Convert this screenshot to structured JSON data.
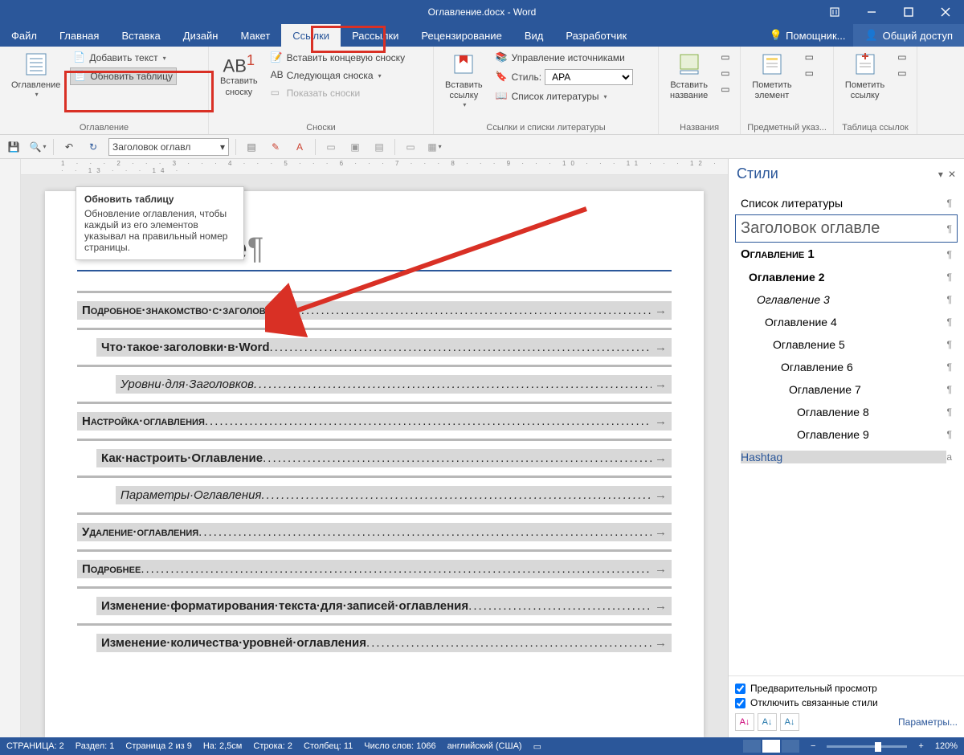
{
  "titlebar": {
    "title": "Оглавление.docx - Word"
  },
  "menu": {
    "tabs": [
      "Файл",
      "Главная",
      "Вставка",
      "Дизайн",
      "Макет",
      "Ссылки",
      "Рассылки",
      "Рецензирование",
      "Вид",
      "Разработчик"
    ],
    "active": "Ссылки",
    "help": "Помощник...",
    "share": "Общий доступ"
  },
  "ribbon": {
    "toc": {
      "label": "Оглавление",
      "btn": "Оглавление",
      "add": "Добавить текст",
      "update": "Обновить таблицу"
    },
    "footnotes": {
      "label": "Сноски",
      "big": "AB",
      "insert": "Вставить\nсноску",
      "end": "Вставить концевую сноску",
      "next": "Следующая сноска",
      "show": "Показать сноски"
    },
    "smart": {
      "label": "",
      "btn": "Вставить\nссылку"
    },
    "citations": {
      "label": "Ссылки и списки литературы",
      "manage": "Управление источниками",
      "style_lbl": "Стиль:",
      "style_val": "APA",
      "bib": "Список литературы"
    },
    "caption": {
      "label": "Названия",
      "btn": "Вставить\nназвание"
    },
    "index": {
      "label": "Предметный указ...",
      "btn": "Пометить\nэлемент"
    },
    "toa": {
      "label": "Таблица ссылок",
      "btn": "Пометить\nссылку"
    }
  },
  "qat": {
    "style": "Заголовок оглавл"
  },
  "tooltip": {
    "title": "Обновить таблицу",
    "body": "Обновление оглавления, чтобы каждый из его элементов указывал на правильный номер страницы."
  },
  "ruler": "1 · · · 2 · · · 3 · · · 4 · · · 5 · · · 6 · · · 7 · · · 8 · · · 9 · · · 10 · · · 11 · · · 12 · · · 13 · · · 14 ·",
  "doc": {
    "heading": "Оглавление",
    "toc": [
      {
        "lvl": 1,
        "t": "Подробное·знакомство·с·заголовками"
      },
      {
        "lvl": 2,
        "t": "Что·такое·заголовки·в·Word"
      },
      {
        "lvl": 3,
        "t": "Уровни·для·Заголовков"
      },
      {
        "lvl": 1,
        "t": "Настройка·оглавления"
      },
      {
        "lvl": 2,
        "t": "Как·настроить·Оглавление"
      },
      {
        "lvl": 3,
        "t": "Параметры·Оглавления"
      },
      {
        "lvl": 1,
        "t": "Удаление·оглавления"
      },
      {
        "lvl": 1,
        "t": "Подробнее"
      },
      {
        "lvl": 2,
        "t": "Изменение·форматирования·текста·для·записей·оглавления"
      },
      {
        "lvl": 2,
        "t": "Изменение·количества·уровней·оглавления"
      }
    ]
  },
  "styles": {
    "title": "Стили",
    "list": [
      {
        "n": "Список литературы",
        "s": false,
        "ind": 0,
        "b": false,
        "i": false,
        "sz": 14,
        "m": "¶"
      },
      {
        "n": "Заголовок оглавле",
        "s": true,
        "ind": 0,
        "b": false,
        "i": false,
        "sz": 20,
        "m": "¶",
        "col": "#595959"
      },
      {
        "n": "Оглавление 1",
        "s": false,
        "ind": 0,
        "b": true,
        "i": false,
        "sz": 15,
        "m": "¶",
        "caps": true
      },
      {
        "n": "Оглавление 2",
        "s": false,
        "ind": 10,
        "b": true,
        "i": false,
        "sz": 14,
        "m": "¶"
      },
      {
        "n": "Оглавление 3",
        "s": false,
        "ind": 20,
        "b": false,
        "i": true,
        "sz": 14,
        "m": "¶"
      },
      {
        "n": "Оглавление 4",
        "s": false,
        "ind": 30,
        "b": false,
        "i": false,
        "sz": 14,
        "m": "¶"
      },
      {
        "n": "Оглавление 5",
        "s": false,
        "ind": 40,
        "b": false,
        "i": false,
        "sz": 14,
        "m": "¶"
      },
      {
        "n": "Оглавление 6",
        "s": false,
        "ind": 50,
        "b": false,
        "i": false,
        "sz": 14,
        "m": "¶"
      },
      {
        "n": "Оглавление 7",
        "s": false,
        "ind": 60,
        "b": false,
        "i": false,
        "sz": 14,
        "m": "¶"
      },
      {
        "n": "Оглавление 8",
        "s": false,
        "ind": 70,
        "b": false,
        "i": false,
        "sz": 14,
        "m": "¶"
      },
      {
        "n": "Оглавление 9",
        "s": false,
        "ind": 70,
        "b": false,
        "i": false,
        "sz": 14,
        "m": "¶"
      },
      {
        "n": "Hashtag",
        "s": false,
        "ind": 0,
        "b": false,
        "i": false,
        "sz": 14,
        "m": "a",
        "col": "#2b579a",
        "hl": true
      }
    ],
    "preview": "Предварительный просмотр",
    "disable": "Отключить связанные стили",
    "params": "Параметры..."
  },
  "status": {
    "page": "СТРАНИЦА: 2",
    "section": "Раздел: 1",
    "pageof": "Страница 2 из 9",
    "pos": "На: 2,5см",
    "line": "Строка: 2",
    "col": "Столбец: 11",
    "words": "Число слов: 1066",
    "lang": "английский (США)",
    "zoom": "120%"
  }
}
